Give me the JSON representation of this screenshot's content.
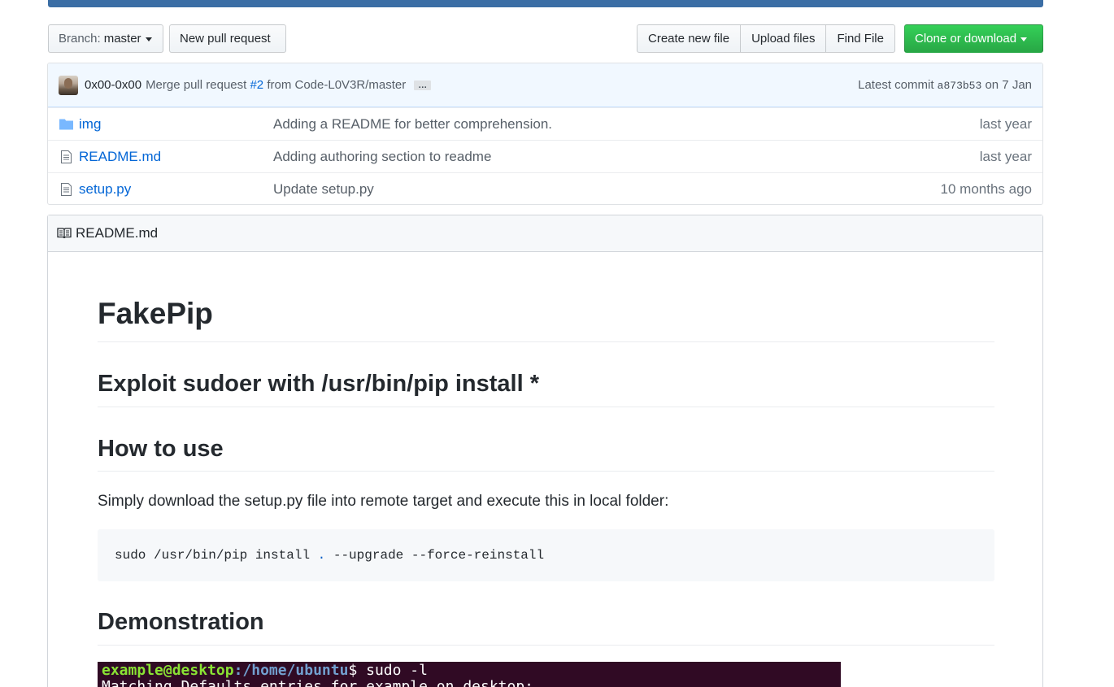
{
  "toolbar": {
    "branch_prefix": "Branch:",
    "branch_name": "master",
    "new_pull_request": "New pull request",
    "create_new_file": "Create new file",
    "upload_files": "Upload files",
    "find_file": "Find File",
    "clone_or_download": "Clone or download"
  },
  "commit": {
    "author": "0x00-0x00",
    "message_prefix": "Merge pull request",
    "pr_link": "#2",
    "message_suffix": "from Code-L0V3R/master",
    "ellipsis": "…",
    "latest_label": "Latest commit",
    "sha": "a873b53",
    "date": "on 7 Jan"
  },
  "files": [
    {
      "name": "img",
      "icon": "folder-icon",
      "message": "Adding a README for better comprehension.",
      "age": "last year"
    },
    {
      "name": "README.md",
      "icon": "file-icon",
      "message": "Adding authoring section to readme",
      "age": "last year"
    },
    {
      "name": "setup.py",
      "icon": "file-icon",
      "message": "Update setup.py",
      "age": "10 months ago"
    }
  ],
  "readme": {
    "header": "README.md",
    "title": "FakePip",
    "subtitle": "Exploit sudoer with /usr/bin/pip install *",
    "section_howto": "How to use",
    "howto_text": "Simply download the setup.py file into remote target and execute this in local folder:",
    "code_before": "sudo /usr/bin/pip install ",
    "code_dot": ".",
    "code_after": " --upgrade --force-reinstall",
    "section_demo": "Demonstration",
    "terminal_user": "example@desktop",
    "terminal_path": ":/home/ubuntu",
    "terminal_cmd": "$ sudo -l",
    "terminal_line2": "Matching Defaults entries for example on desktop:"
  },
  "colors": {
    "accent_blue": "#0366d6",
    "clone_green": "#28a745",
    "terminal_bg": "#300a24"
  }
}
